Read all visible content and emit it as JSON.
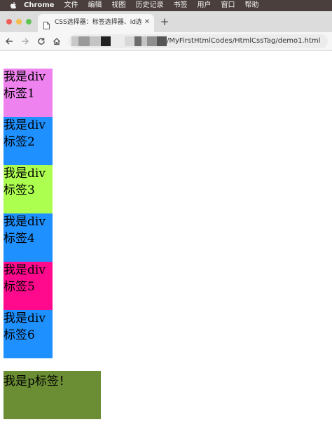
{
  "menubar": {
    "app_name": "Chrome",
    "items": [
      "文件",
      "编辑",
      "视图",
      "历史记录",
      "书签",
      "用户",
      "窗口",
      "帮助"
    ]
  },
  "tab": {
    "title": "CSS选择器：标签选择器、id选择器",
    "close_icon": "close-icon",
    "new_tab_icon": "plus-icon"
  },
  "toolbar": {
    "url_visible": "/MyFirstHtmlCodes/HtmlCssTag/demo1.html"
  },
  "page": {
    "divs": [
      {
        "text": "我是div标签1",
        "color": "#ee82ee"
      },
      {
        "text": "我是div标签2",
        "color": "#1e90ff"
      },
      {
        "text": "我是div标签3",
        "color": "#adff4f"
      },
      {
        "text": "我是div标签4",
        "color": "#1e90ff"
      },
      {
        "text": "我是div标签5",
        "color": "#ff0a8c"
      },
      {
        "text": "我是div标签6",
        "color": "#1e90ff"
      }
    ],
    "p": {
      "text": "我是p标签！",
      "color": "#6b8e34"
    }
  }
}
